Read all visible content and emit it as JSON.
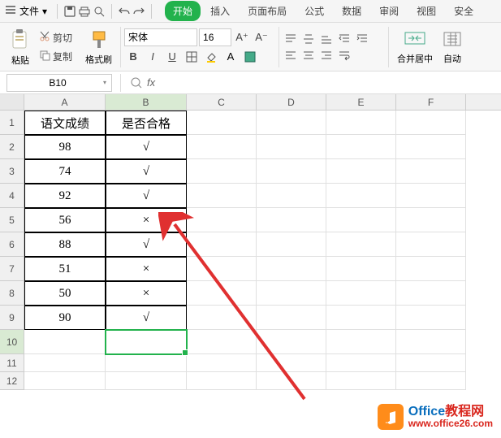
{
  "titlebar": {
    "menu_label": "文件"
  },
  "tabs": [
    "开始",
    "插入",
    "页面布局",
    "公式",
    "数据",
    "审阅",
    "视图",
    "安全"
  ],
  "active_tab_index": 0,
  "ribbon": {
    "cut": "剪切",
    "copy": "复制",
    "paste": "粘贴",
    "format_painter": "格式刷",
    "font_name": "宋体",
    "font_size": "16",
    "merge_center": "合并居中",
    "autosum": "自动"
  },
  "namebox": "B10",
  "formula_fx": "fx",
  "columns": [
    "A",
    "B",
    "C",
    "D",
    "E",
    "F"
  ],
  "row_numbers": [
    "1",
    "2",
    "3",
    "4",
    "5",
    "6",
    "7",
    "8",
    "9",
    "10",
    "11",
    "12"
  ],
  "table": {
    "headerA": "语文成绩",
    "headerB": "是否合格",
    "rows": [
      {
        "a": "98",
        "b": "√"
      },
      {
        "a": "74",
        "b": "√"
      },
      {
        "a": "92",
        "b": "√"
      },
      {
        "a": "56",
        "b": "×"
      },
      {
        "a": "88",
        "b": "√"
      },
      {
        "a": "51",
        "b": "×"
      },
      {
        "a": "50",
        "b": "×"
      },
      {
        "a": "90",
        "b": "√"
      }
    ]
  },
  "watermark": {
    "brand1": "Office",
    "brand2": "教程网",
    "url": "www.office26.com"
  }
}
